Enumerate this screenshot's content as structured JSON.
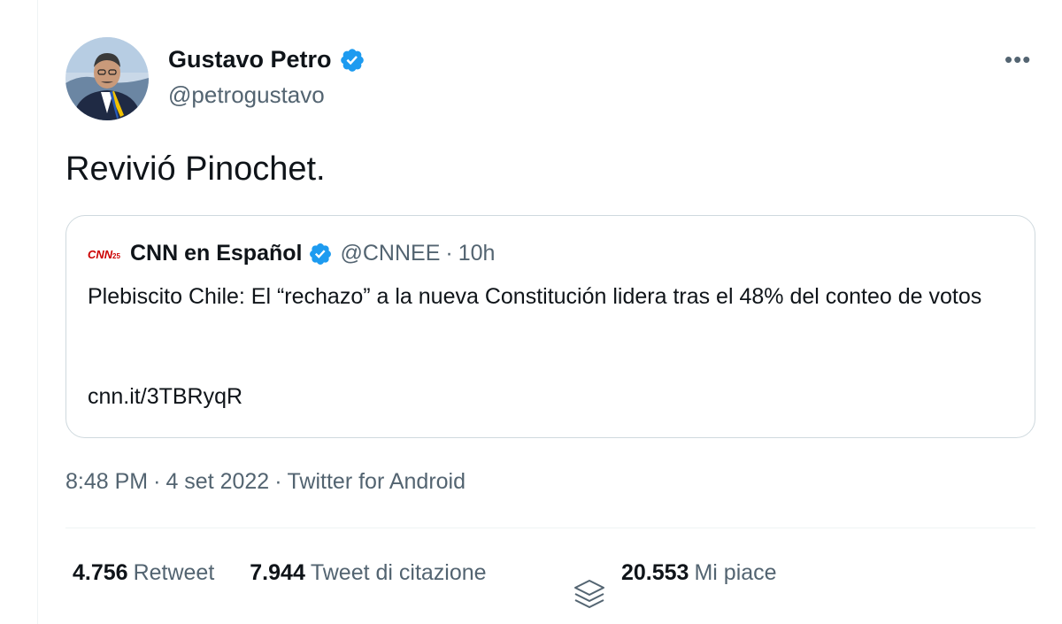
{
  "author": {
    "display_name": "Gustavo Petro",
    "handle": "@petrogustavo",
    "verified_color": "#1d9bf0"
  },
  "more_label": "•••",
  "tweet": {
    "text": "Revivió Pinochet."
  },
  "quoted": {
    "logo_icon": "cnn-logo-icon",
    "display_name": "CNN en Español",
    "handle": "@CNNEE",
    "separator": "·",
    "time": "10h",
    "text": "Plebiscito Chile: El “rechazo” a la nueva Constitución lidera tras el 48% del conteo de votos",
    "link": "cnn.it/3TBRyqR"
  },
  "meta": {
    "time": "8:48 PM",
    "date": "4 set 2022",
    "source": "Twitter for Android",
    "separator": "·"
  },
  "stats": {
    "retweets": {
      "count": "4.756",
      "label": "Retweet"
    },
    "quotes": {
      "count": "7.944",
      "label": "Tweet di citazione"
    },
    "likes": {
      "count": "20.553",
      "label": "Mi piace"
    }
  },
  "colors": {
    "text_primary": "#0f1419",
    "text_secondary": "#536471",
    "border": "#cfd9de",
    "verified": "#1d9bf0",
    "cnn_red": "#cc0000"
  }
}
